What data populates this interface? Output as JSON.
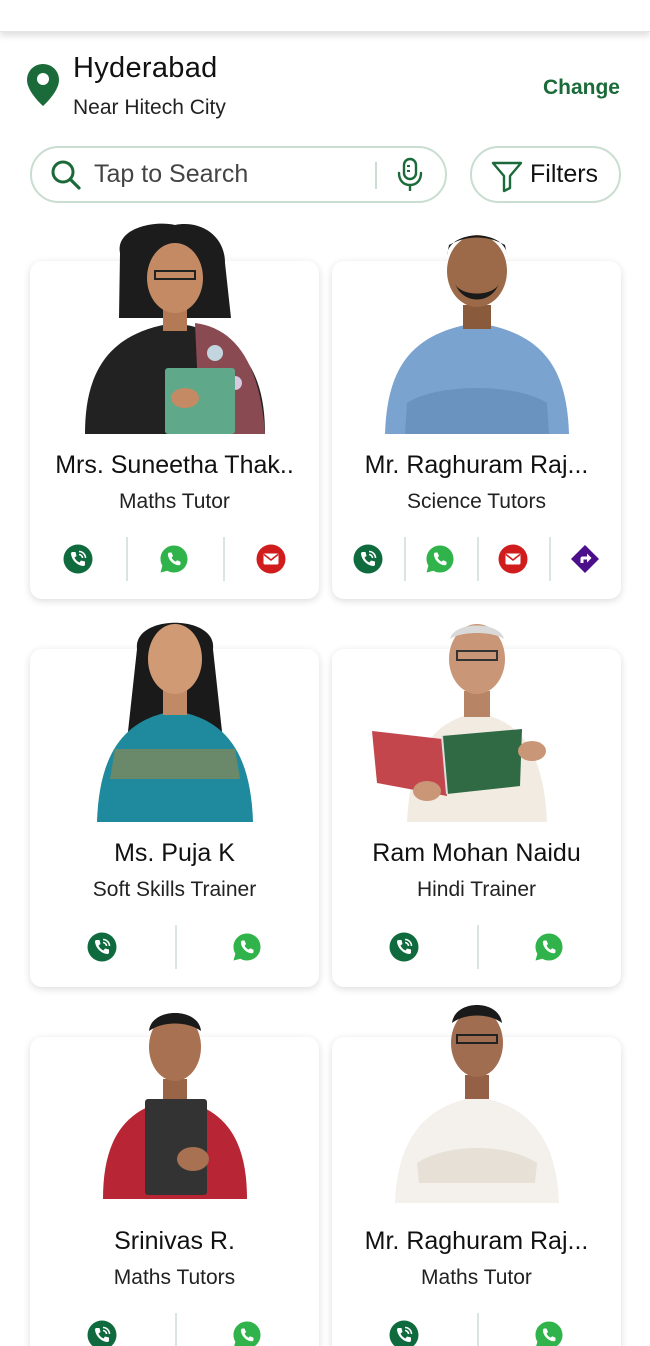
{
  "location": {
    "city": "Hyderabad",
    "area": "Near Hitech City",
    "change_label": "Change"
  },
  "search": {
    "placeholder": "Tap to Search",
    "filters_label": "Filters"
  },
  "colors": {
    "brand_green": "#1b6b3a",
    "call_green": "#0f6b3d",
    "whatsapp_green": "#2fb34a",
    "mail_red": "#d01c1c",
    "directions_purple": "#4b0f8c"
  },
  "tutors": [
    {
      "name": "Mrs. Suneetha Thak..",
      "role": "Maths Tutor",
      "actions": [
        "call",
        "whatsapp",
        "email"
      ]
    },
    {
      "name": "Mr. Raghuram Raj...",
      "role": "Science Tutors",
      "actions": [
        "call",
        "whatsapp",
        "email",
        "directions"
      ]
    },
    {
      "name": "Ms. Puja K",
      "role": "Soft Skills Trainer",
      "actions": [
        "call",
        "whatsapp"
      ]
    },
    {
      "name": "Ram Mohan Naidu",
      "role": "Hindi Trainer",
      "actions": [
        "call",
        "whatsapp"
      ]
    },
    {
      "name": "Srinivas R.",
      "role": "Maths Tutors",
      "actions": [
        "call",
        "whatsapp"
      ]
    },
    {
      "name": "Mr. Raghuram Raj...",
      "role": "Maths Tutor",
      "actions": [
        "call",
        "whatsapp"
      ]
    }
  ]
}
